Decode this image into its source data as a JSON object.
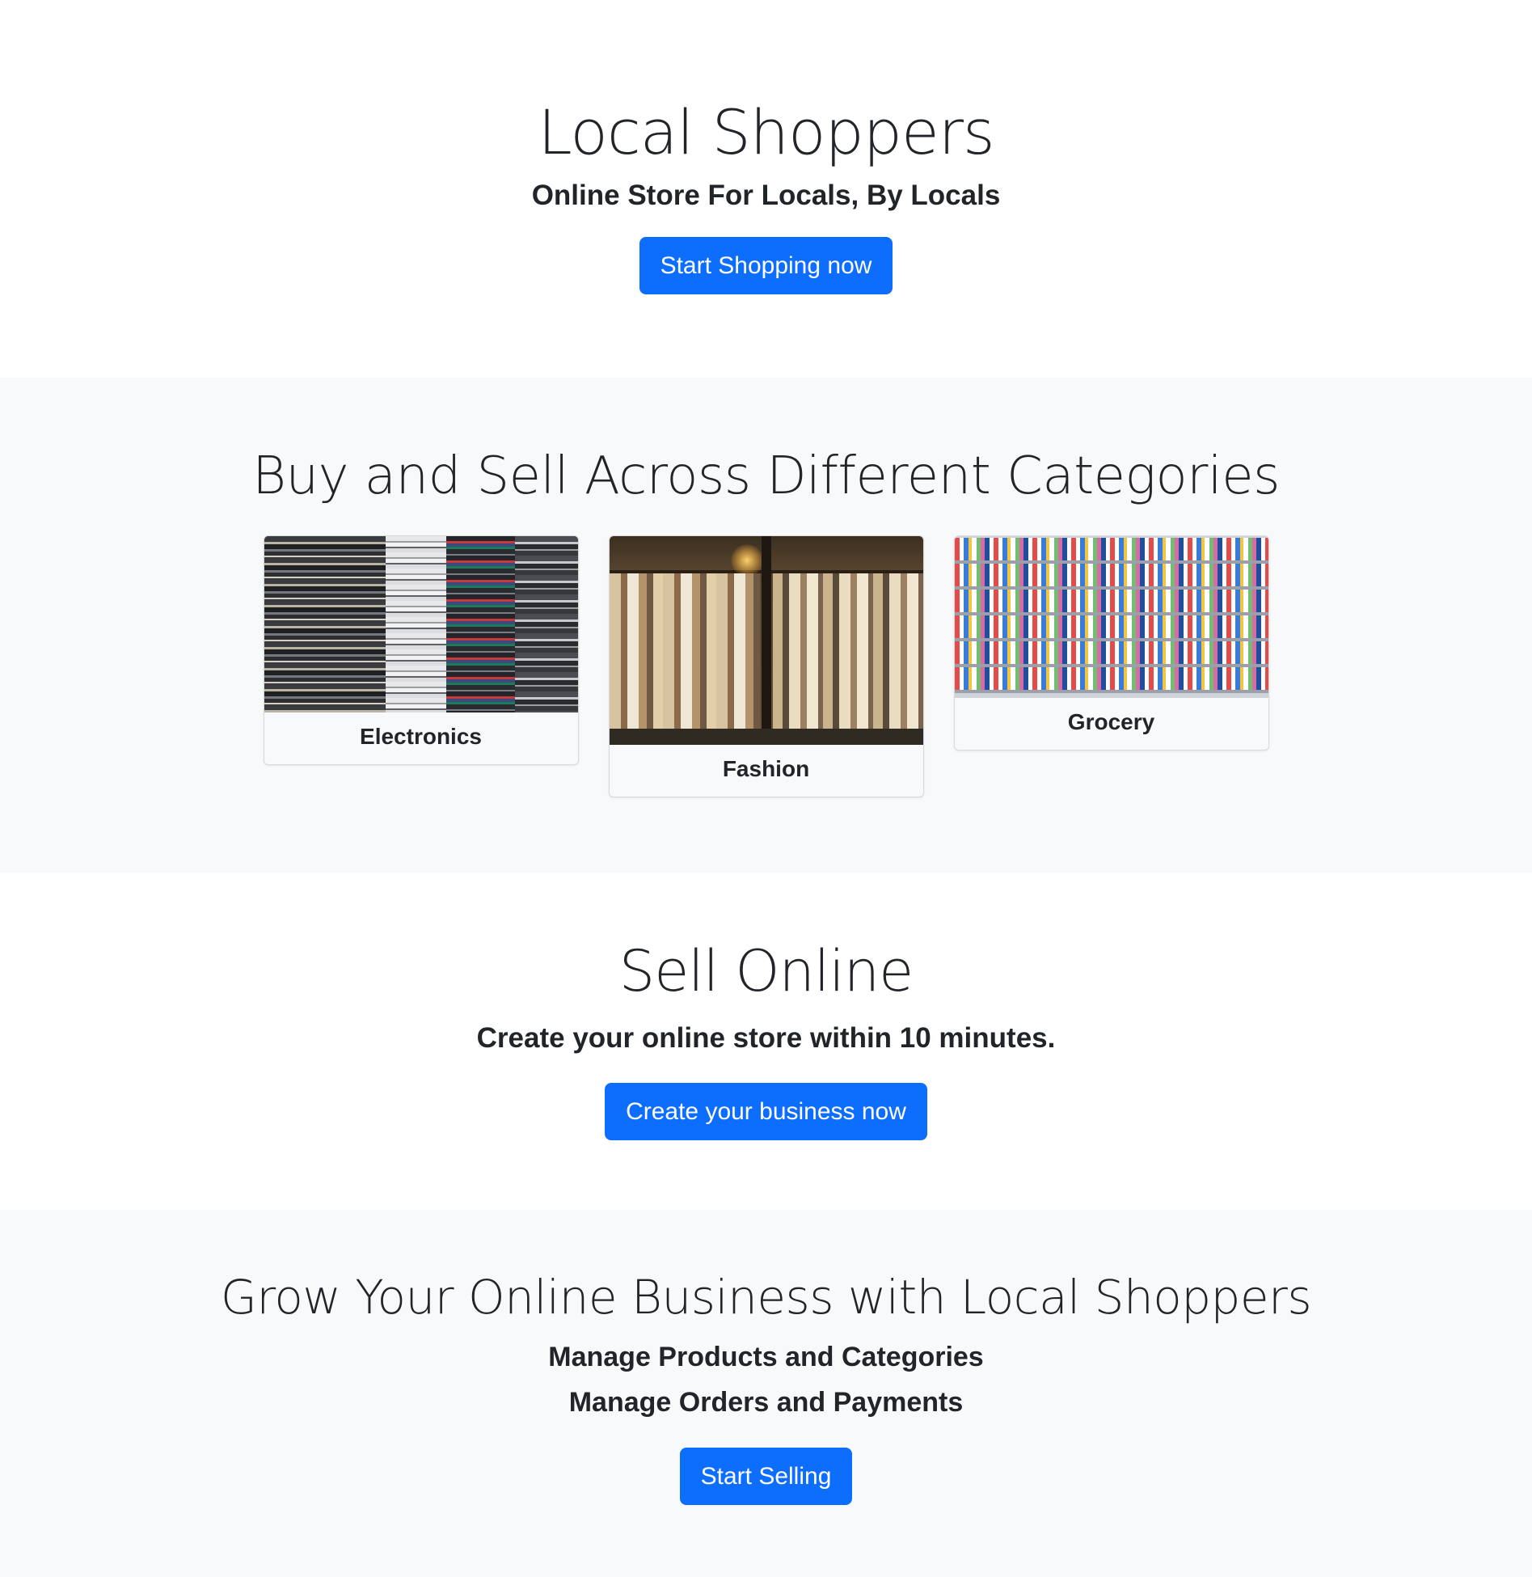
{
  "hero": {
    "title": "Local Shoppers",
    "subtitle": "Online Store For Locals, By Locals",
    "button_label": "Start Shopping now"
  },
  "categories": {
    "title": "Buy and Sell Across Different Categories",
    "items": [
      {
        "label": "Electronics",
        "image": "stacked-phones-image"
      },
      {
        "label": "Fashion",
        "image": "clothes-rack-image"
      },
      {
        "label": "Grocery",
        "image": "grocery-shelves-image"
      }
    ]
  },
  "sell": {
    "title": "Sell Online",
    "subtitle": "Create your online store within 10 minutes.",
    "button_label": "Create your business now"
  },
  "grow": {
    "title": "Grow Your Online Business with Local Shoppers",
    "lines": [
      "Manage Products and Categories",
      "Manage Orders and Payments"
    ],
    "button_label": "Start Selling"
  },
  "colors": {
    "primary": "#0d6efd",
    "light_bg": "#f8f9fa",
    "text": "#212529"
  }
}
